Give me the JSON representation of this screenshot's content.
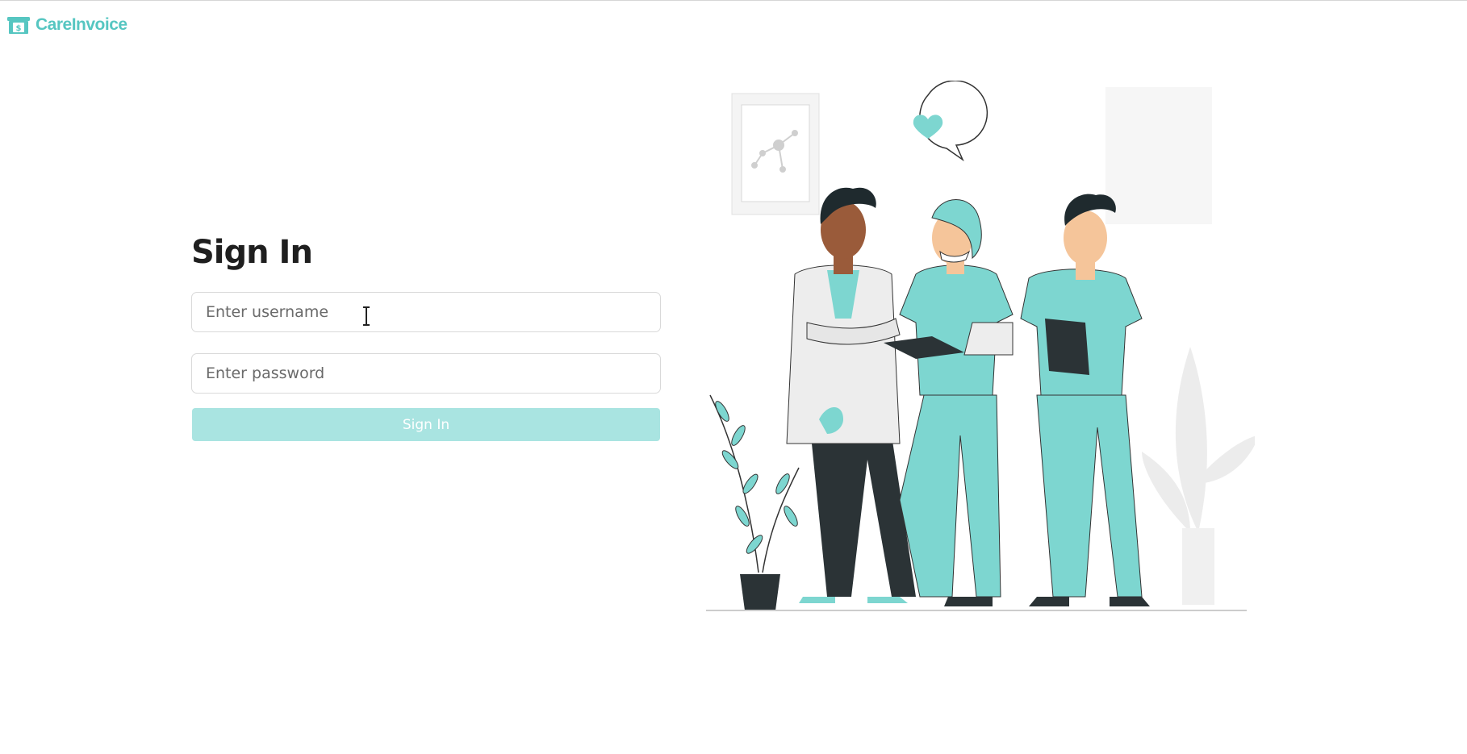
{
  "brand": {
    "name": "CareInvoice",
    "icon": "invoice-register-icon",
    "color": "#56c6c1"
  },
  "form": {
    "title": "Sign In",
    "username_placeholder": "Enter username",
    "password_placeholder": "Enter password",
    "submit_label": "Sign In"
  },
  "colors": {
    "accent": "#56c6c1",
    "button_disabled": "#a9e4e1",
    "scrubs": "#7dd6d0",
    "dark": "#2b3336"
  },
  "illustration": {
    "subject": "medical-staff-illustration"
  }
}
